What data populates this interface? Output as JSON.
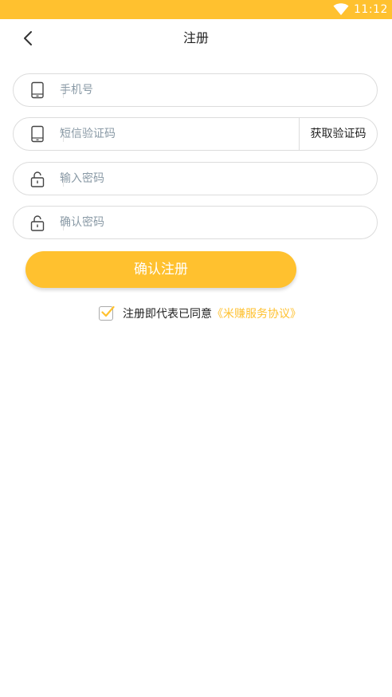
{
  "status_bar": {
    "time": "11:12",
    "background": "#ffc12f",
    "icons": [
      "wifi-icon"
    ]
  },
  "header": {
    "title": "注册",
    "back_icon": "chevron-left-icon"
  },
  "form": {
    "phone": {
      "placeholder": "手机号",
      "value": "",
      "icon": "phone-icon"
    },
    "sms_code": {
      "placeholder": "短信验证码",
      "value": "",
      "icon": "phone-icon",
      "button_label": "获取验证码"
    },
    "password": {
      "placeholder": "输入密码",
      "value": "",
      "icon": "lock-icon"
    },
    "confirm_password": {
      "placeholder": "确认密码",
      "value": "",
      "icon": "lock-icon"
    }
  },
  "submit": {
    "label": "确认注册",
    "color": "#ffc12f"
  },
  "agreement": {
    "checked": true,
    "text": "注册即代表已同意",
    "link_text": "《米赚服务协议》",
    "link_color": "#ffc12f"
  }
}
